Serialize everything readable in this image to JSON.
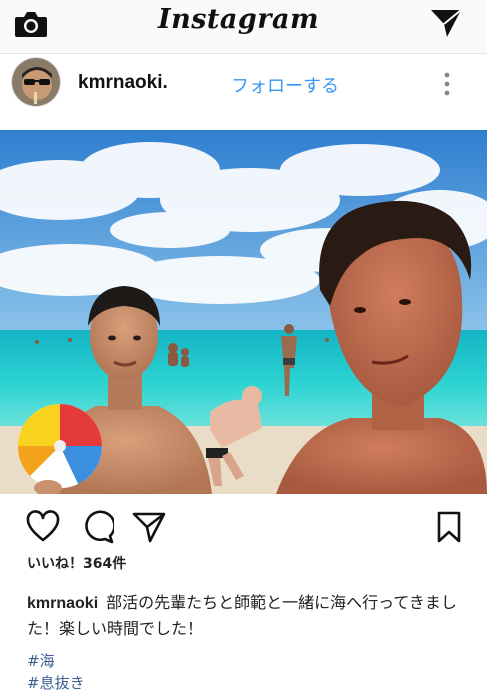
{
  "app": {
    "logo_text": "Instagram"
  },
  "topbar": {
    "camera_icon": "camera-icon",
    "direct_icon": "paper-plane-icon"
  },
  "post": {
    "username": "kmrnaoki.",
    "follow_label": "フォローする",
    "more_icon": "vertical-dots-icon",
    "actions": {
      "like_icon": "heart-icon",
      "comment_icon": "comment-bubble-icon",
      "share_icon": "paper-plane-icon",
      "save_icon": "bookmark-icon"
    },
    "likes_text": "いいね！364件",
    "caption_user": "kmrnaoki",
    "caption_text": "部活の先輩たちと師範と一緒に海へ行ってきました！楽しい時間でした！",
    "hashtags": [
      "#海",
      "#息抜き"
    ]
  },
  "colors": {
    "link_blue": "#3897f0",
    "hashtag_blue": "#3b5e93",
    "text": "#111111"
  }
}
